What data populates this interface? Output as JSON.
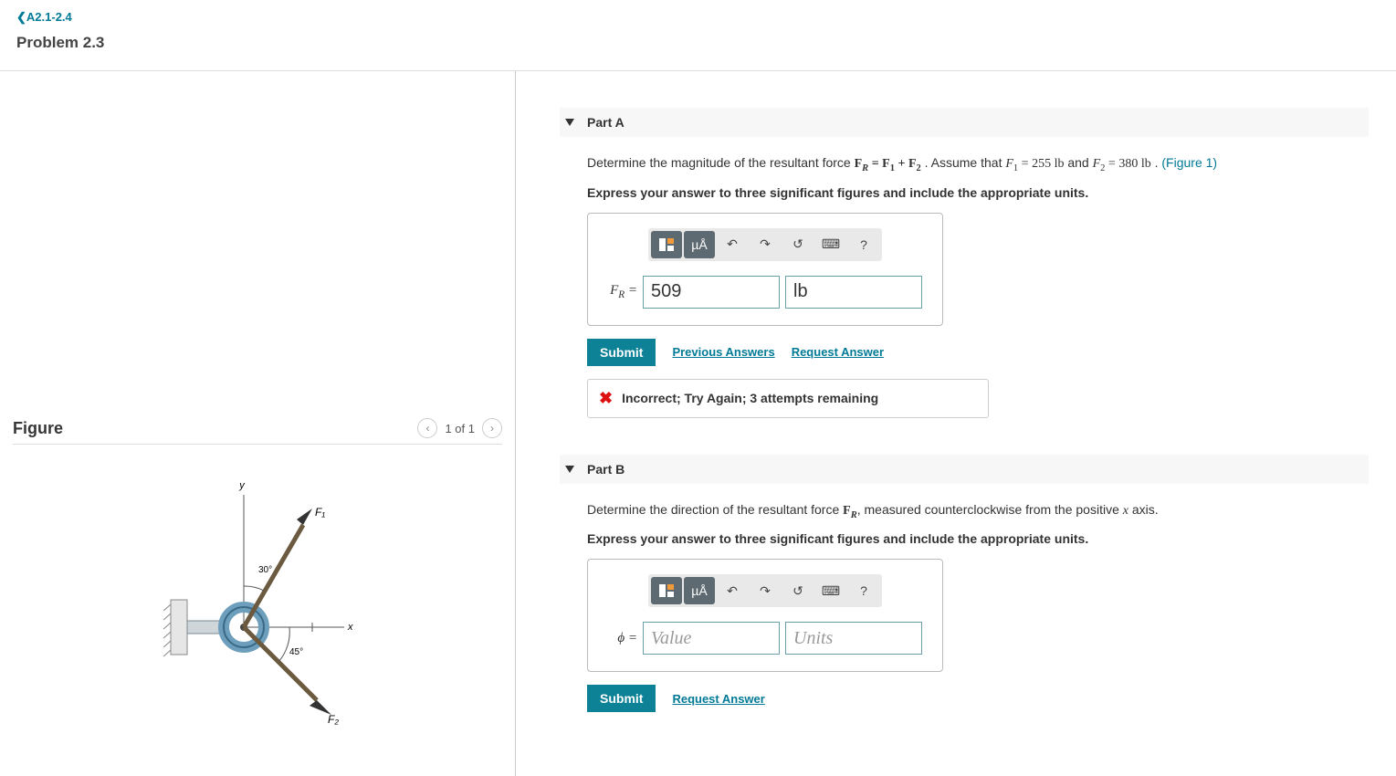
{
  "header": {
    "back_link": "A2.1-2.4",
    "problem_title": "Problem 2.3"
  },
  "figure": {
    "title": "Figure",
    "pager_text": "1 of 1",
    "labels": {
      "y_axis": "y",
      "x_axis": "x",
      "f1": "F₁",
      "f2": "F₂",
      "angle1": "30°",
      "angle2": "45°"
    }
  },
  "parts": [
    {
      "title": "Part A",
      "prompt_pre": "Determine the magnitude of the resultant force ",
      "prompt_eq": "F_R = F_1 + F_2",
      "prompt_mid": " . Assume that ",
      "assume1": "F₁ = 255 lb",
      "assume_and": " and ",
      "assume2": "F₂ = 380 lb",
      "prompt_post": " . ",
      "figure_link": "(Figure 1)",
      "instruction": "Express your answer to three significant figures and include the appropriate units.",
      "toolbar": {
        "units_label": "µÅ",
        "help": "?"
      },
      "var_label": "F_R =",
      "value": "509",
      "units": "lb",
      "submit": "Submit",
      "prev_answers": "Previous Answers",
      "request_answer": "Request Answer",
      "feedback": "Incorrect; Try Again; 3 attempts remaining"
    },
    {
      "title": "Part B",
      "prompt_pre": "Determine the direction of the resultant force ",
      "prompt_eq_var": "F_R",
      "prompt_post": ", measured counterclockwise from the positive ",
      "axis_var": "x",
      "prompt_end": " axis.",
      "instruction": "Express your answer to three significant figures and include the appropriate units.",
      "toolbar": {
        "units_label": "µÅ",
        "help": "?"
      },
      "var_label": "ϕ =",
      "value_placeholder": "Value",
      "units_placeholder": "Units",
      "submit": "Submit",
      "request_answer": "Request Answer"
    }
  ]
}
